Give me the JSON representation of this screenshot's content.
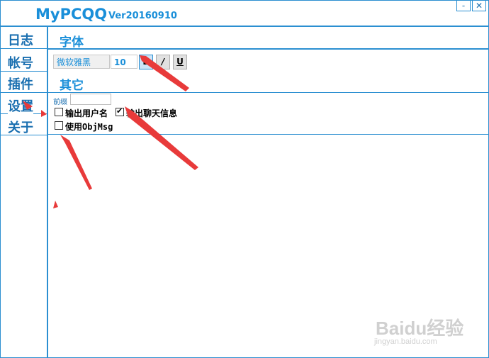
{
  "window": {
    "title": "MyPCQQ",
    "version": "Ver20160910",
    "minimize_label": "-",
    "close_label": "✕"
  },
  "sidebar": {
    "items": [
      {
        "label": "日志"
      },
      {
        "label": "帐号"
      },
      {
        "label": "插件"
      },
      {
        "label": "设置"
      },
      {
        "label": "关于"
      }
    ],
    "selected": "设置"
  },
  "settings": {
    "font_heading": "字体",
    "font_name": "微软雅黑",
    "font_size": "10",
    "bold_label": "B",
    "italic_label": "/",
    "underline_label": "U",
    "other_heading": "其它",
    "prefix_label": "前缀",
    "prefix_value": "",
    "options": [
      {
        "label": "输出用户名",
        "checked": false
      },
      {
        "label": "输出聊天信息",
        "checked": true
      },
      {
        "label": "使用ObjMsg",
        "checked": false
      }
    ]
  },
  "watermark": {
    "brand": "Baidu经验",
    "url": "jingyan.baidu.com"
  },
  "colors": {
    "accent": "#2b8fd1",
    "annotation_arrow": "#e83a3a"
  }
}
